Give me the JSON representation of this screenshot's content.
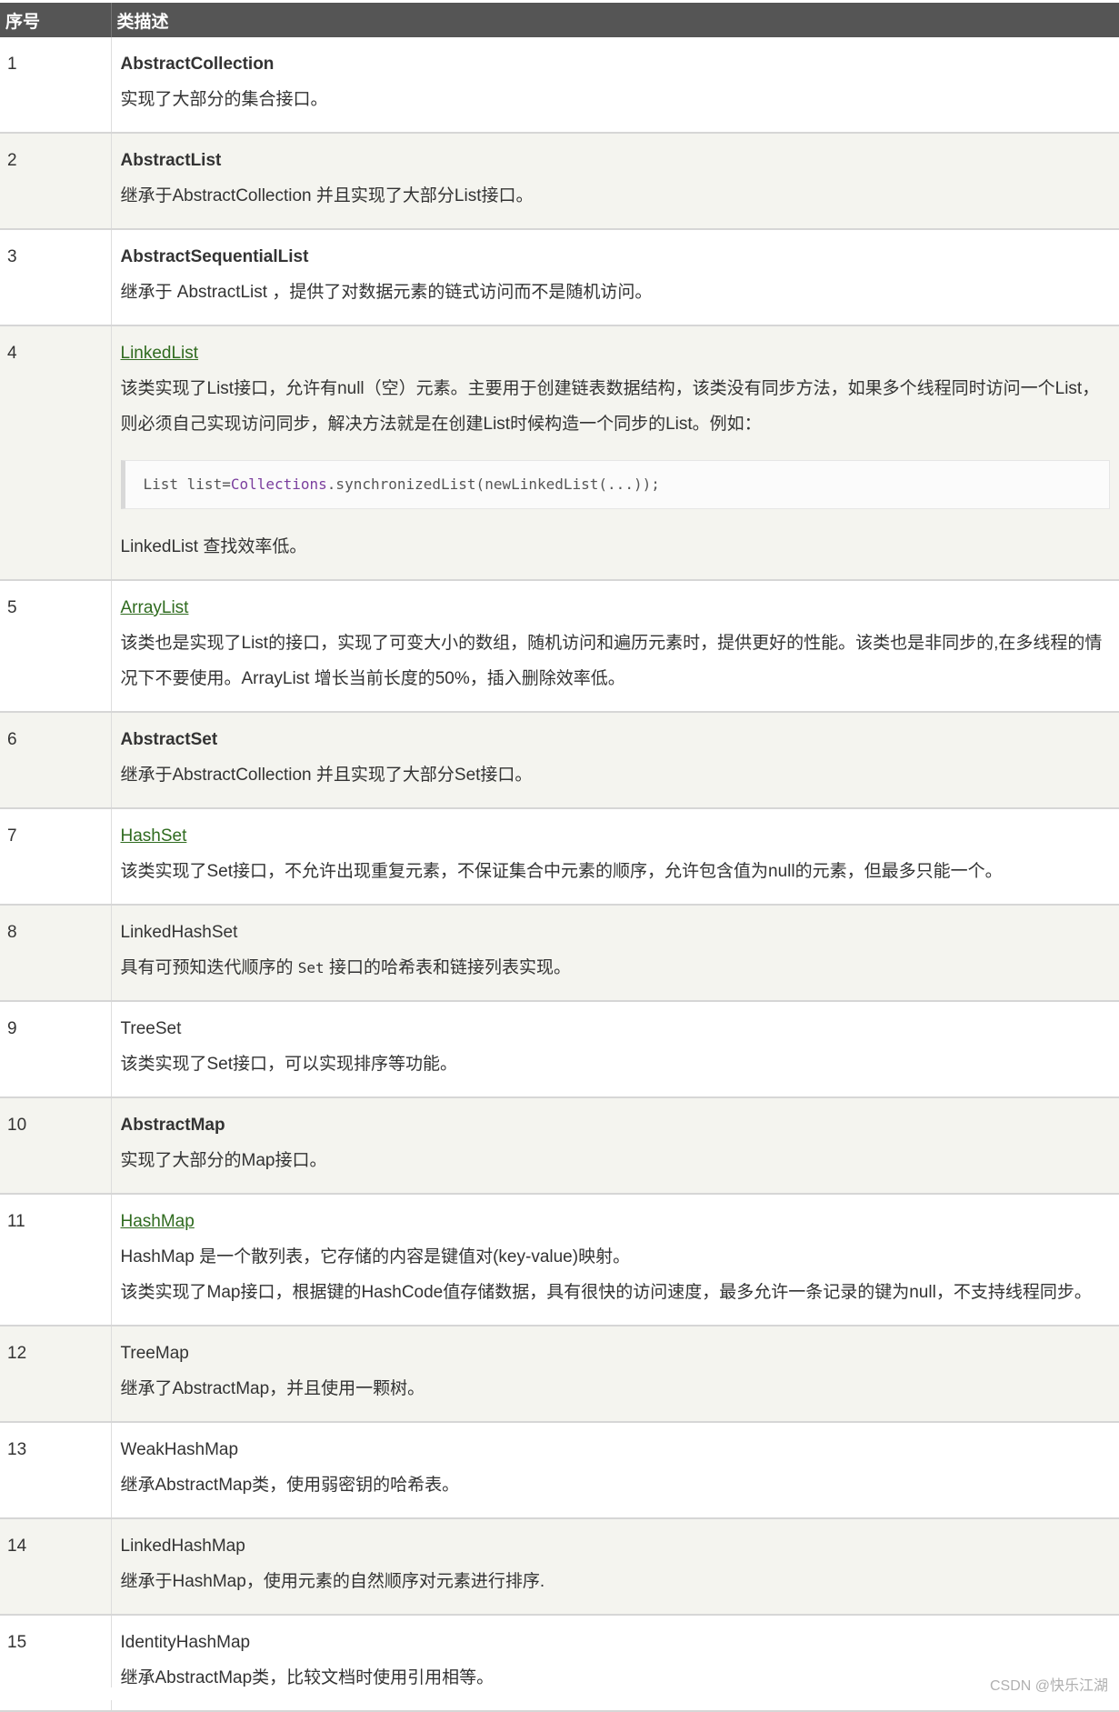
{
  "table": {
    "headers": [
      "序号",
      "类描述"
    ],
    "rows": [
      {
        "num": "1",
        "name": "AbstractCollection",
        "style": "bold",
        "lines": [
          "实现了大部分的集合接口。"
        ]
      },
      {
        "num": "2",
        "name": "AbstractList",
        "style": "bold",
        "lines": [
          "继承于AbstractCollection 并且实现了大部分List接口。"
        ]
      },
      {
        "num": "3",
        "name": "AbstractSequentialList",
        "style": "bold",
        "lines": [
          "继承于 AbstractList ，提供了对数据元素的链式访问而不是随机访问。"
        ]
      },
      {
        "num": "4",
        "name": "LinkedList",
        "style": "link",
        "lines": [
          "该类实现了List接口，允许有null（空）元素。主要用于创建链表数据结构，该类没有同步方法，如果多个线程同时访问一个List，则必须自己实现访问同步，解决方法就是在创建List时候构造一个同步的List。例如："
        ],
        "code": {
          "prefix": "List list=",
          "cls": "Collections",
          "rest": ".synchronizedList(newLinkedList(...));"
        },
        "after": "LinkedList 查找效率低。"
      },
      {
        "num": "5",
        "name": "ArrayList",
        "style": "link",
        "lines": [
          "该类也是实现了List的接口，实现了可变大小的数组，随机访问和遍历元素时，提供更好的性能。该类也是非同步的,在多线程的情况下不要使用。ArrayList 增长当前长度的50%，插入删除效率低。"
        ]
      },
      {
        "num": "6",
        "name": "AbstractSet",
        "style": "bold",
        "lines": [
          "继承于AbstractCollection 并且实现了大部分Set接口。"
        ]
      },
      {
        "num": "7",
        "name": "HashSet",
        "style": "link",
        "lines": [
          "该类实现了Set接口，不允许出现重复元素，不保证集合中元素的顺序，允许包含值为null的元素，但最多只能一个。"
        ]
      },
      {
        "num": "8",
        "name": "LinkedHashSet",
        "style": "plain",
        "line_parts": {
          "before": "具有可预知迭代顺序的 ",
          "code": "Set",
          "after": " 接口的哈希表和链接列表实现。"
        }
      },
      {
        "num": "9",
        "name": "TreeSet",
        "style": "plain",
        "lines": [
          "该类实现了Set接口，可以实现排序等功能。"
        ]
      },
      {
        "num": "10",
        "name": "AbstractMap",
        "style": "bold",
        "lines": [
          "实现了大部分的Map接口。"
        ]
      },
      {
        "num": "11",
        "name": "HashMap",
        "style": "link",
        "lines": [
          "HashMap 是一个散列表，它存储的内容是键值对(key-value)映射。",
          "该类实现了Map接口，根据键的HashCode值存储数据，具有很快的访问速度，最多允许一条记录的键为null，不支持线程同步。"
        ]
      },
      {
        "num": "12",
        "name": "TreeMap",
        "style": "plain",
        "lines": [
          "继承了AbstractMap，并且使用一颗树。"
        ]
      },
      {
        "num": "13",
        "name": "WeakHashMap",
        "style": "plain",
        "lines": [
          "继承AbstractMap类，使用弱密钥的哈希表。"
        ]
      },
      {
        "num": "14",
        "name": "LinkedHashMap",
        "style": "plain",
        "lines": [
          "继承于HashMap，使用元素的自然顺序对元素进行排序."
        ]
      },
      {
        "num": "15",
        "name": "IdentityHashMap",
        "style": "plain",
        "lines": [
          "继承AbstractMap类，比较文档时使用引用相等。"
        ]
      }
    ]
  },
  "watermark": "CSDN @快乐江湖",
  "colors": {
    "header_bg": "#555555",
    "link": "#2f6b1f",
    "row_alt": "#f4f4ef"
  }
}
